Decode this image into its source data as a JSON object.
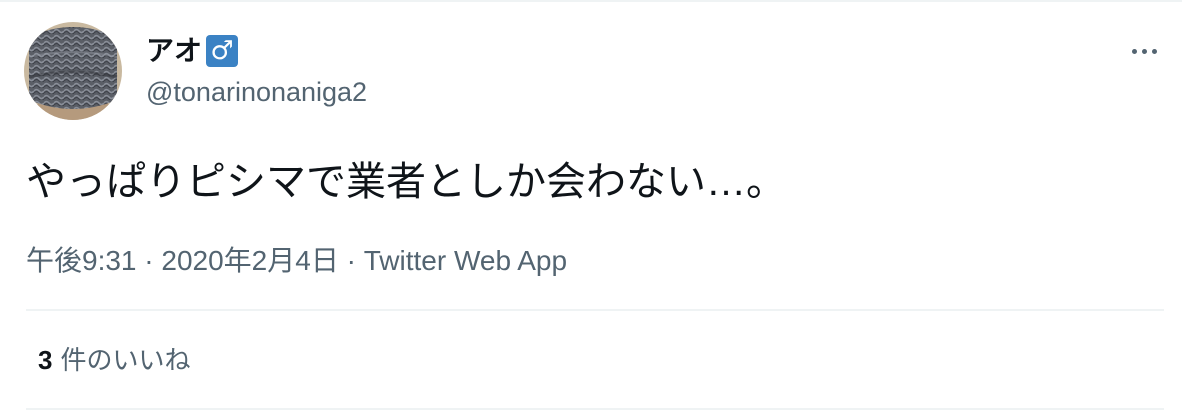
{
  "user": {
    "display_name": "アオ",
    "badge_glyph": "♂",
    "handle": "@tonarinonaniga2"
  },
  "tweet": {
    "text": "やっぱりピシマで業者としか会わない…。",
    "time": "午後9:31",
    "date": "2020年2月4日",
    "separator": "·",
    "source": "Twitter Web App"
  },
  "engagement": {
    "likes_count": "3",
    "likes_label": "件のいいね"
  },
  "icons": {
    "more": "more-options-icon",
    "avatar": "user-avatar"
  },
  "colors": {
    "text_primary": "#0f1419",
    "text_secondary": "#536471",
    "divider": "#eff3f4",
    "badge_bg": "#3b82c4"
  }
}
